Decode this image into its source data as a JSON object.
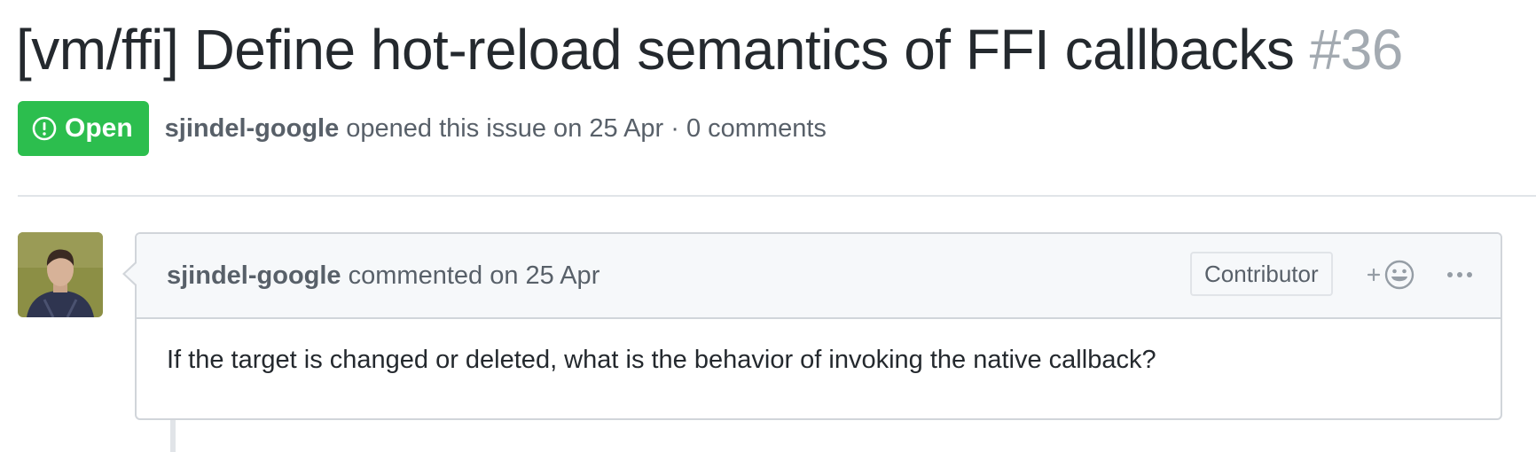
{
  "issue": {
    "title": "[vm/ffi] Define hot-reload semantics of FFI callbacks",
    "number": "#36",
    "state": "Open",
    "state_icon": "issue-opened-icon",
    "author": "sjindel-google",
    "meta_text": " opened this issue on 25 Apr · 0 comments"
  },
  "comment": {
    "author": "sjindel-google",
    "header_text": " commented on 25 Apr",
    "role": "Contributor",
    "reaction_plus": "+",
    "body": "If the target is changed or deleted, what is the behavior of invoking the native callback?"
  },
  "colors": {
    "open_green": "#2cbe4e",
    "muted_text": "#586069",
    "border": "#d1d5da",
    "header_bg": "#f6f8fa"
  }
}
